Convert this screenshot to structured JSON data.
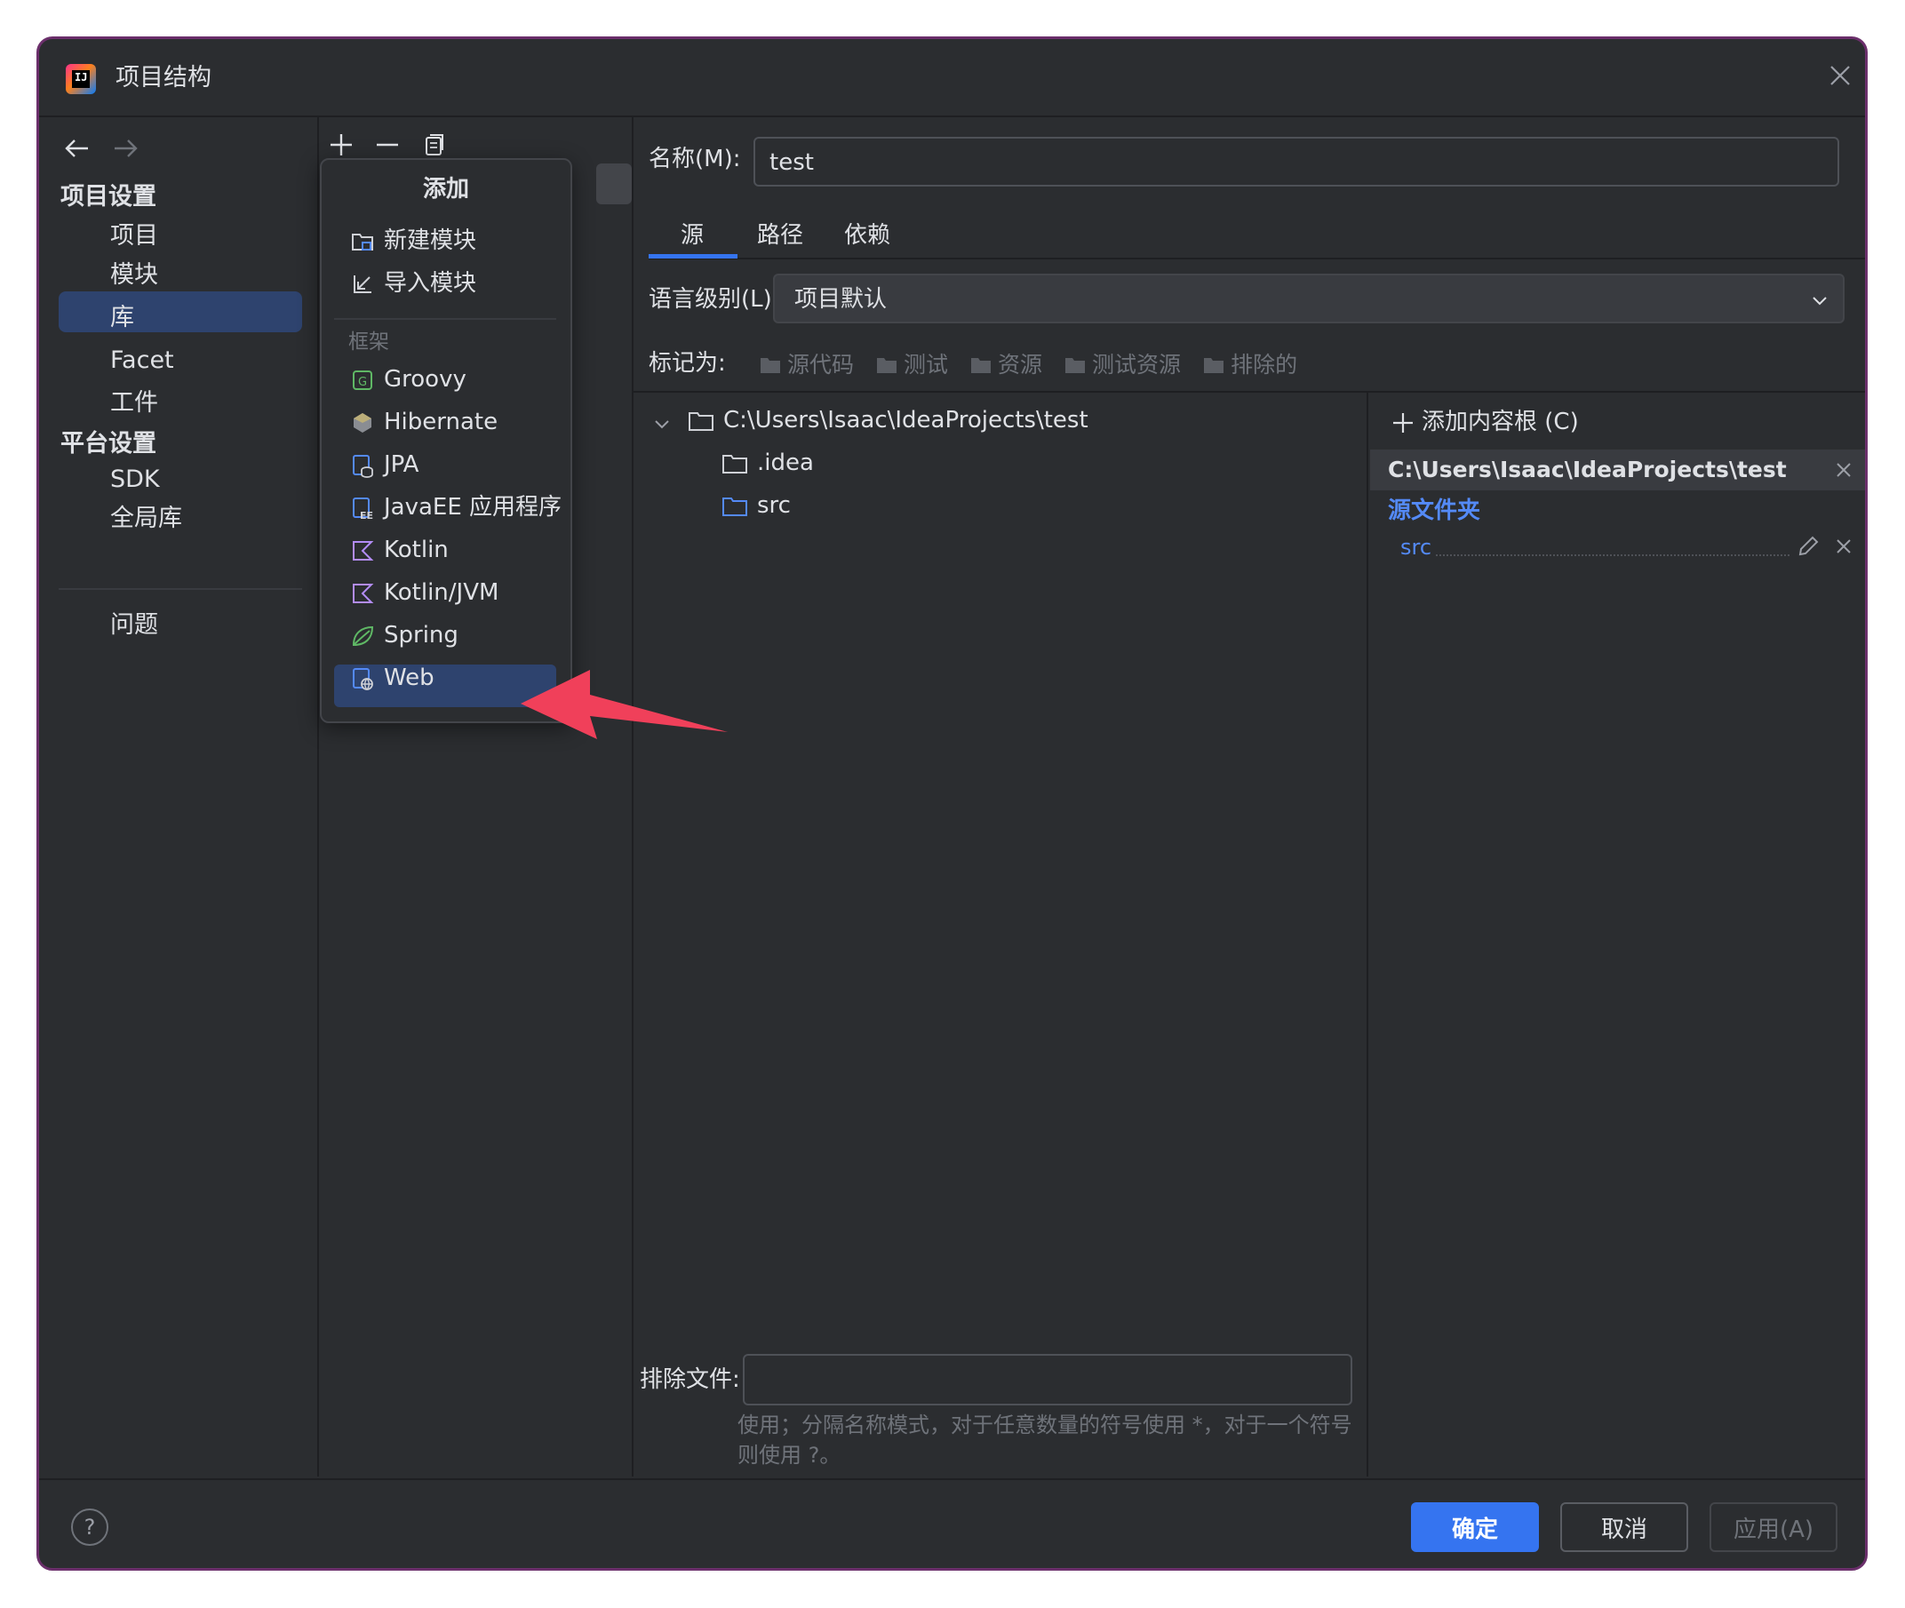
{
  "window": {
    "title": "项目结构"
  },
  "nav": {
    "back_icon": "arrow-left-icon",
    "forward_icon": "arrow-right-icon",
    "project_settings_header": "项目设置",
    "items": [
      {
        "label": "项目"
      },
      {
        "label": "模块",
        "selected": true
      },
      {
        "label": "库"
      },
      {
        "label": "Facet"
      },
      {
        "label": "工件"
      }
    ],
    "platform_settings_header": "平台设置",
    "platform_items": [
      {
        "label": "SDK"
      },
      {
        "label": "全局库"
      }
    ],
    "problems": "问题"
  },
  "popup": {
    "title": "添加",
    "actions": [
      {
        "label": "新建模块",
        "icon": "new-module-icon"
      },
      {
        "label": "导入模块",
        "icon": "import-module-icon"
      }
    ],
    "section_label": "框架",
    "frameworks": [
      {
        "label": "Groovy",
        "icon": "groovy-icon"
      },
      {
        "label": "Hibernate",
        "icon": "hibernate-icon"
      },
      {
        "label": "JPA",
        "icon": "jpa-icon"
      },
      {
        "label": "JavaEE 应用程序",
        "icon": "javaee-icon"
      },
      {
        "label": "Kotlin",
        "icon": "kotlin-icon"
      },
      {
        "label": "Kotlin/JVM",
        "icon": "kotlin-icon"
      },
      {
        "label": "Spring",
        "icon": "spring-icon"
      },
      {
        "label": "Web",
        "icon": "web-icon",
        "selected": true
      }
    ]
  },
  "module": {
    "name_label": "名称(M):",
    "name_value": "test",
    "tabs": [
      {
        "label": "源",
        "active": true
      },
      {
        "label": "路径"
      },
      {
        "label": "依赖"
      }
    ],
    "language_level_label": "语言级别(L):",
    "language_level_value": "项目默认",
    "mark_as_label": "标记为:",
    "mark_as_options": [
      "源代码",
      "测试",
      "资源",
      "测试资源",
      "排除的"
    ],
    "tree": {
      "root": "C:\\Users\\Isaac\\IdeaProjects\\test",
      "children": [
        ".idea",
        "src"
      ]
    },
    "content_root": {
      "add_label": "添加内容根 (C)",
      "path": "C:\\Users\\Isaac\\IdeaProjects\\test",
      "source_folders_label": "源文件夹",
      "source_folder": "src"
    },
    "exclude_files_label": "排除文件:",
    "exclude_files_value": "",
    "hint_line1": "使用；分隔名称模式，对于任意数量的符号使用 *，对于一个符号",
    "hint_line2": "则使用 ?。"
  },
  "footer": {
    "help": "?",
    "ok": "确定",
    "cancel": "取消",
    "apply": "应用(A)"
  },
  "colors": {
    "background": "#2b2d30",
    "selection": "#2e436e",
    "accent": "#3574f0",
    "link": "#548af7",
    "arrow": "#f0405a"
  }
}
